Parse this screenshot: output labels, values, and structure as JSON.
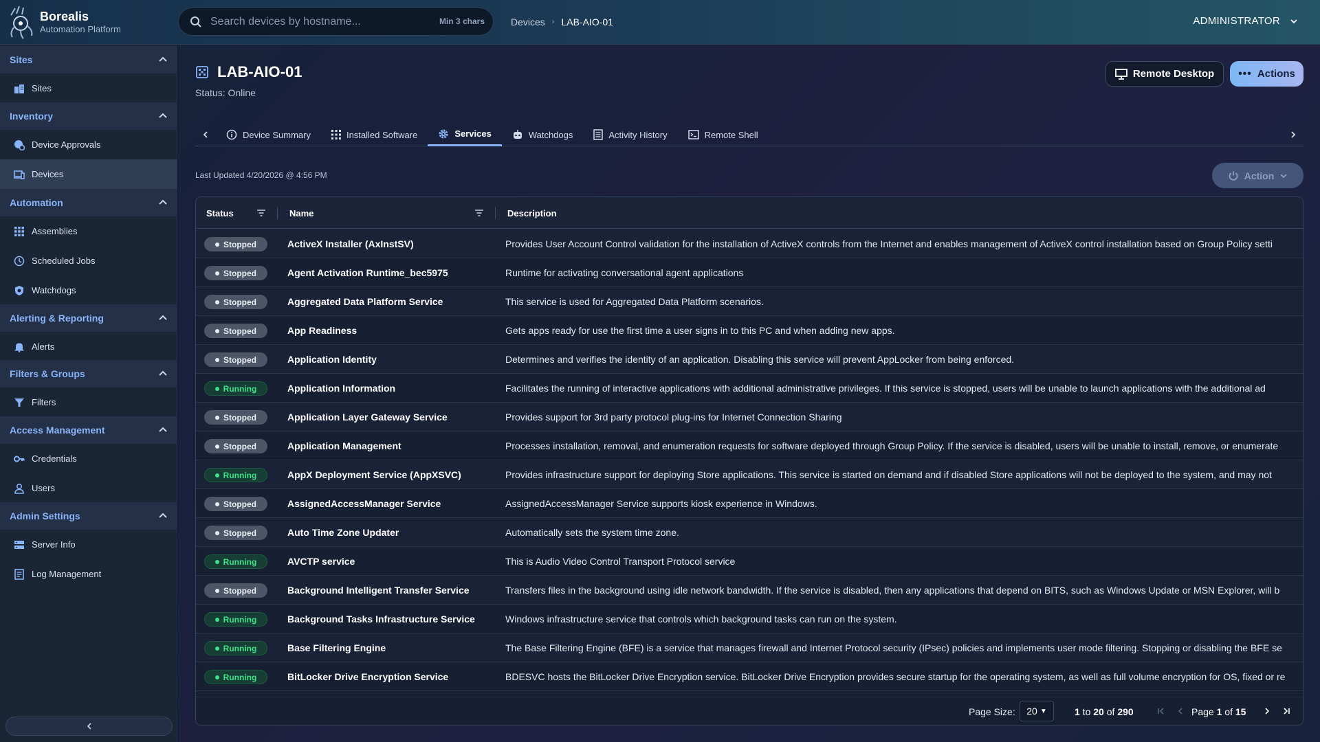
{
  "brand": {
    "name": "Borealis",
    "subtitle": "Automation Platform"
  },
  "search": {
    "placeholder": "Search devices by hostname...",
    "hint": "Min 3 chars"
  },
  "breadcrumb": [
    "Devices",
    "LAB-AIO-01"
  ],
  "user": {
    "name": "ADMINISTRATOR"
  },
  "sidebar": {
    "groups": [
      {
        "title": "Sites",
        "items": [
          {
            "label": "Sites",
            "icon": "building-icon"
          }
        ]
      },
      {
        "title": "Inventory",
        "items": [
          {
            "label": "Device Approvals",
            "icon": "approval-icon"
          },
          {
            "label": "Devices",
            "icon": "devices-icon",
            "active": true
          }
        ]
      },
      {
        "title": "Automation",
        "items": [
          {
            "label": "Assemblies",
            "icon": "grid-icon"
          },
          {
            "label": "Scheduled Jobs",
            "icon": "clock-icon"
          },
          {
            "label": "Watchdogs",
            "icon": "shield-icon"
          }
        ]
      },
      {
        "title": "Alerting & Reporting",
        "items": [
          {
            "label": "Alerts",
            "icon": "bell-icon"
          }
        ]
      },
      {
        "title": "Filters & Groups",
        "items": [
          {
            "label": "Filters",
            "icon": "filter-icon"
          }
        ]
      },
      {
        "title": "Access Management",
        "items": [
          {
            "label": "Credentials",
            "icon": "key-icon"
          },
          {
            "label": "Users",
            "icon": "user-icon"
          }
        ]
      },
      {
        "title": "Admin Settings",
        "items": [
          {
            "label": "Server Info",
            "icon": "server-icon"
          },
          {
            "label": "Log Management",
            "icon": "log-icon"
          }
        ]
      }
    ]
  },
  "device": {
    "name": "LAB-AIO-01",
    "status": "Status: Online"
  },
  "buttons": {
    "remote_desktop": "Remote Desktop",
    "actions": "Actions",
    "action": "Action"
  },
  "tabs": [
    {
      "label": "Device Summary",
      "icon": "info-icon"
    },
    {
      "label": "Installed Software",
      "icon": "grid-icon"
    },
    {
      "label": "Services",
      "icon": "gear-icon",
      "active": true
    },
    {
      "label": "Watchdogs",
      "icon": "robot-icon"
    },
    {
      "label": "Activity History",
      "icon": "history-icon"
    },
    {
      "label": "Remote Shell",
      "icon": "terminal-icon"
    }
  ],
  "last_updated": "Last Updated 4/20/2026 @ 4:56 PM",
  "table": {
    "columns": [
      "Status",
      "Name",
      "Description"
    ],
    "rows": [
      {
        "status": "Stopped",
        "name": "ActiveX Installer (AxInstSV)",
        "description": "Provides User Account Control validation for the installation of ActiveX controls from the Internet and enables management of ActiveX control installation based on Group Policy setti"
      },
      {
        "status": "Stopped",
        "name": "Agent Activation Runtime_bec5975",
        "description": "Runtime for activating conversational agent applications"
      },
      {
        "status": "Stopped",
        "name": "Aggregated Data Platform Service",
        "description": "This service is used for Aggregated Data Platform scenarios."
      },
      {
        "status": "Stopped",
        "name": "App Readiness",
        "description": "Gets apps ready for use the first time a user signs in to this PC and when adding new apps."
      },
      {
        "status": "Stopped",
        "name": "Application Identity",
        "description": "Determines and verifies the identity of an application. Disabling this service will prevent AppLocker from being enforced."
      },
      {
        "status": "Running",
        "name": "Application Information",
        "description": "Facilitates the running of interactive applications with additional administrative privileges. If this service is stopped, users will be unable to launch applications with the additional ad"
      },
      {
        "status": "Stopped",
        "name": "Application Layer Gateway Service",
        "description": "Provides support for 3rd party protocol plug-ins for Internet Connection Sharing"
      },
      {
        "status": "Stopped",
        "name": "Application Management",
        "description": "Processes installation, removal, and enumeration requests for software deployed through Group Policy. If the service is disabled, users will be unable to install, remove, or enumerate"
      },
      {
        "status": "Running",
        "name": "AppX Deployment Service (AppXSVC)",
        "description": "Provides infrastructure support for deploying Store applications. This service is started on demand and if disabled Store applications will not be deployed to the system, and may not"
      },
      {
        "status": "Stopped",
        "name": "AssignedAccessManager Service",
        "description": "AssignedAccessManager Service supports kiosk experience in Windows."
      },
      {
        "status": "Stopped",
        "name": "Auto Time Zone Updater",
        "description": "Automatically sets the system time zone."
      },
      {
        "status": "Running",
        "name": "AVCTP service",
        "description": "This is Audio Video Control Transport Protocol service"
      },
      {
        "status": "Stopped",
        "name": "Background Intelligent Transfer Service",
        "description": "Transfers files in the background using idle network bandwidth. If the service is disabled, then any applications that depend on BITS, such as Windows Update or MSN Explorer, will b"
      },
      {
        "status": "Running",
        "name": "Background Tasks Infrastructure Service",
        "description": "Windows infrastructure service that controls which background tasks can run on the system."
      },
      {
        "status": "Running",
        "name": "Base Filtering Engine",
        "description": "The Base Filtering Engine (BFE) is a service that manages firewall and Internet Protocol security (IPsec) policies and implements user mode filtering. Stopping or disabling the BFE se"
      },
      {
        "status": "Running",
        "name": "BitLocker Drive Encryption Service",
        "description": "BDESVC hosts the BitLocker Drive Encryption service. BitLocker Drive Encryption provides secure startup for the operating system, as well as full volume encryption for OS, fixed or re"
      }
    ]
  },
  "pagination": {
    "page_size_label": "Page Size:",
    "page_size": "20",
    "range_from": "1",
    "range_to": "20",
    "range_total": "290",
    "page_current": "1",
    "page_total": "15"
  },
  "colors": {
    "accent": "#8ab4f8",
    "running": "#3ee08a",
    "stopped": "#4d5666"
  }
}
